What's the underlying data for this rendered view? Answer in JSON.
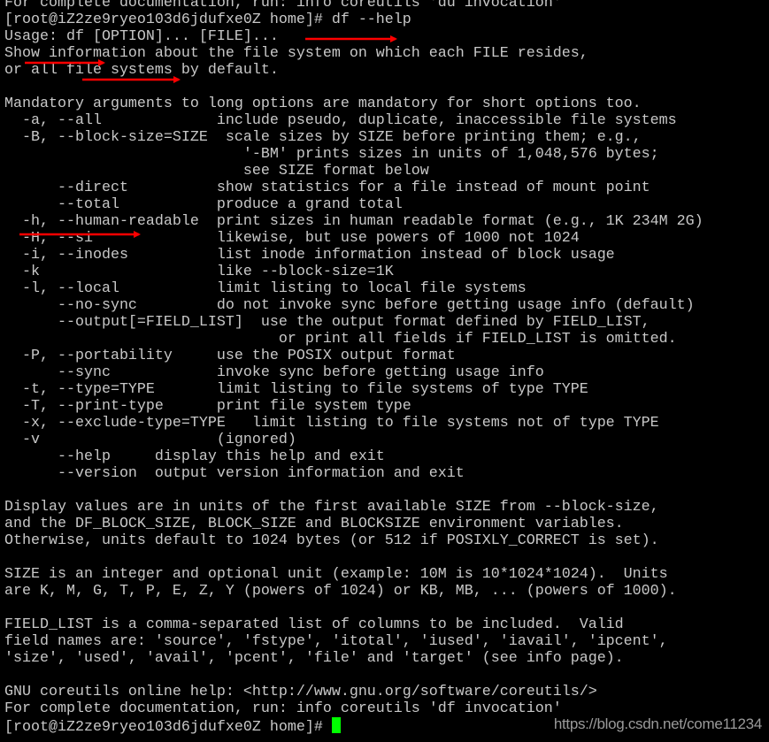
{
  "terminal": {
    "lines": [
      "For complete documentation, run: info coreutils 'du invocation'",
      "[root@iZ2ze9ryeo103d6jdufxe0Z home]# df --help",
      "Usage: df [OPTION]... [FILE]...",
      "Show information about the file system on which each FILE resides,",
      "or all file systems by default.",
      "",
      "Mandatory arguments to long options are mandatory for short options too.",
      "  -a, --all             include pseudo, duplicate, inaccessible file systems",
      "  -B, --block-size=SIZE  scale sizes by SIZE before printing them; e.g.,",
      "                           '-BM' prints sizes in units of 1,048,576 bytes;",
      "                           see SIZE format below",
      "      --direct          show statistics for a file instead of mount point",
      "      --total           produce a grand total",
      "  -h, --human-readable  print sizes in human readable format (e.g., 1K 234M 2G)",
      "  -H, --si              likewise, but use powers of 1000 not 1024",
      "  -i, --inodes          list inode information instead of block usage",
      "  -k                    like --block-size=1K",
      "  -l, --local           limit listing to local file systems",
      "      --no-sync         do not invoke sync before getting usage info (default)",
      "      --output[=FIELD_LIST]  use the output format defined by FIELD_LIST,",
      "                               or print all fields if FIELD_LIST is omitted.",
      "  -P, --portability     use the POSIX output format",
      "      --sync            invoke sync before getting usage info",
      "  -t, --type=TYPE       limit listing to file systems of type TYPE",
      "  -T, --print-type      print file system type",
      "  -x, --exclude-type=TYPE   limit listing to file systems not of type TYPE",
      "  -v                    (ignored)",
      "      --help     display this help and exit",
      "      --version  output version information and exit",
      "",
      "Display values are in units of the first available SIZE from --block-size,",
      "and the DF_BLOCK_SIZE, BLOCK_SIZE and BLOCKSIZE environment variables.",
      "Otherwise, units default to 1024 bytes (or 512 if POSIXLY_CORRECT is set).",
      "",
      "SIZE is an integer and optional unit (example: 10M is 10*1024*1024).  Units",
      "are K, M, G, T, P, E, Z, Y (powers of 1024) or KB, MB, ... (powers of 1000).",
      "",
      "FIELD_LIST is a comma-separated list of columns to be included.  Valid",
      "field names are: 'source', 'fstype', 'itotal', 'iused', 'iavail', 'ipcent',",
      "'size', 'used', 'avail', 'pcent', 'file' and 'target' (see info page).",
      "",
      "GNU coreutils online help: <http://www.gnu.org/software/coreutils/>",
      "For complete documentation, run: info coreutils 'df invocation'"
    ],
    "prompt": "[root@iZ2ze9ryeo103d6jdufxe0Z home]# ",
    "colors": {
      "text": "#c8c8c8",
      "background": "#000000",
      "cursor": "#00ff00",
      "annotation_arrow": "#ff0000"
    }
  },
  "watermark": "https://blog.csdn.net/come11234"
}
